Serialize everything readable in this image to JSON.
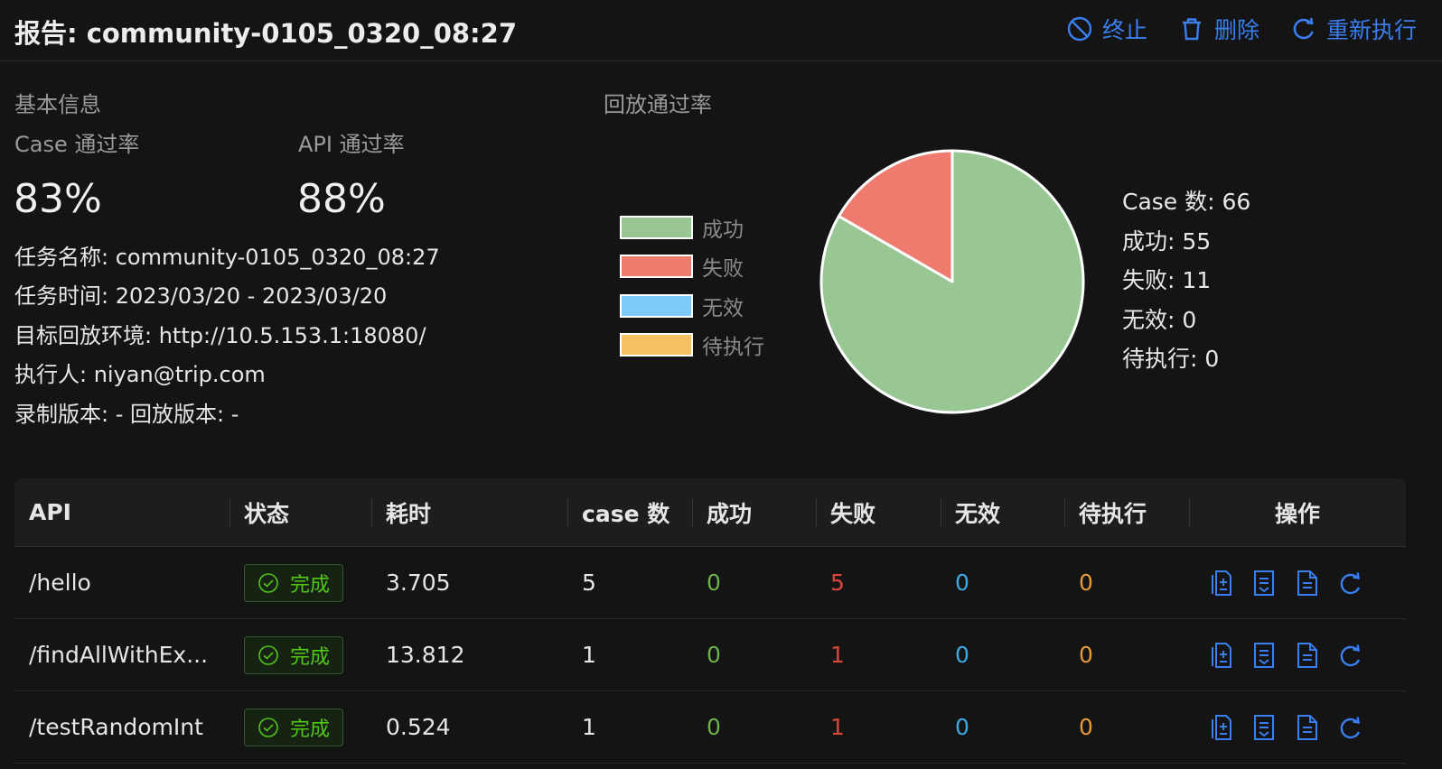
{
  "header": {
    "title": "报告: community-0105_0320_08:27",
    "actions": {
      "stop": "终止",
      "delete": "删除",
      "rerun": "重新执行"
    }
  },
  "basic_info": {
    "title": "基本信息",
    "case_rate_label": "Case 通过率",
    "case_rate_value": "83%",
    "api_rate_label": "API 通过率",
    "api_rate_value": "88%",
    "task_name": "任务名称: community-0105_0320_08:27",
    "task_time": "任务时间: 2023/03/20 - 2023/03/20",
    "target_env": "目标回放环境: http://10.5.153.1:18080/",
    "executor": "执行人: niyan@trip.com",
    "versions": "录制版本: - 回放版本: -"
  },
  "replay": {
    "title": "回放通过率",
    "legend": [
      {
        "label": "成功",
        "color": "#98c794"
      },
      {
        "label": "失败",
        "color": "#ee7b6d"
      },
      {
        "label": "无效",
        "color": "#7ecbfa"
      },
      {
        "label": "待执行",
        "color": "#f6c163"
      }
    ],
    "counts": [
      "Case 数: 66",
      "成功: 55",
      "失败: 11",
      "无效: 0",
      "待执行: 0"
    ]
  },
  "chart_data": {
    "type": "pie",
    "title": "",
    "labels": [
      "成功",
      "失败",
      "无效",
      "待执行"
    ],
    "values": [
      55,
      11,
      0,
      0
    ],
    "colors": [
      "#98c794",
      "#ee7b6d",
      "#7ecbfa",
      "#f6c163"
    ]
  },
  "table": {
    "headers": [
      "API",
      "状态",
      "耗时",
      "case 数",
      "成功",
      "失败",
      "无效",
      "待执行",
      "操作"
    ],
    "rows": [
      {
        "api": "/hello",
        "status": "完成",
        "time": "3.705",
        "cases": "5",
        "success": "0",
        "fail": "5",
        "invalid": "0",
        "pending": "0"
      },
      {
        "api": "/findAllWithEx...",
        "status": "完成",
        "time": "13.812",
        "cases": "1",
        "success": "0",
        "fail": "1",
        "invalid": "0",
        "pending": "0"
      },
      {
        "api": "/testRandomInt",
        "status": "完成",
        "time": "0.524",
        "cases": "1",
        "success": "0",
        "fail": "1",
        "invalid": "0",
        "pending": "0"
      }
    ]
  }
}
